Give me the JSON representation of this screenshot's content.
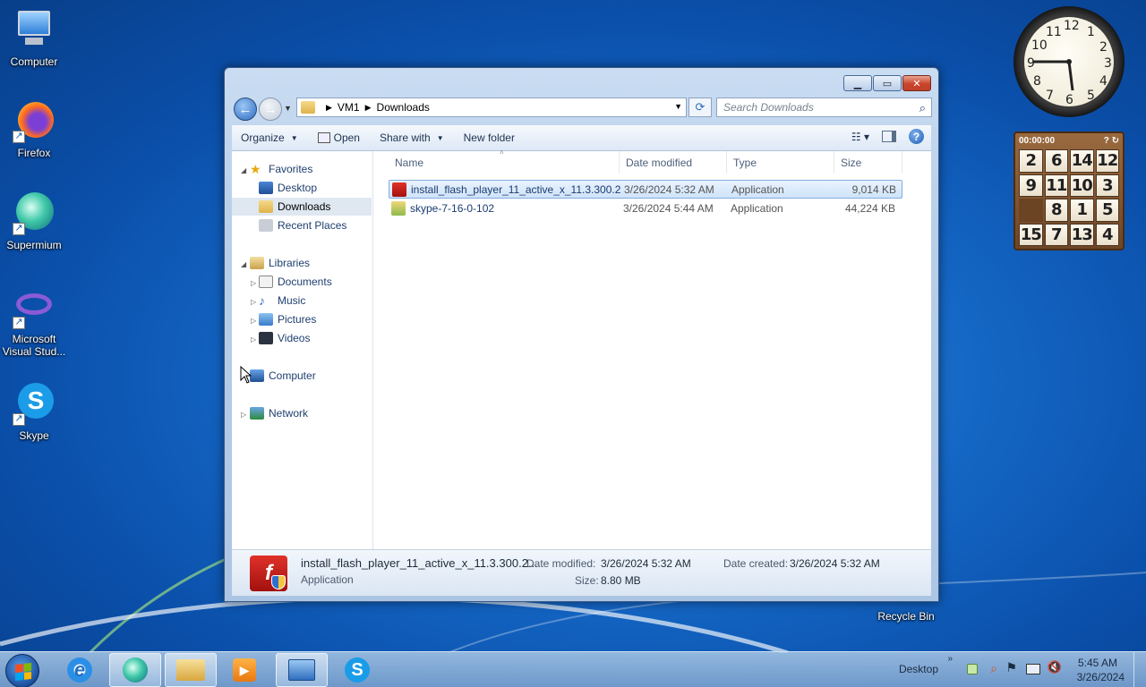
{
  "desktop": {
    "icons": [
      {
        "label": "Computer"
      },
      {
        "label": "Firefox"
      },
      {
        "label": "Supermium"
      },
      {
        "label": "Microsoft Visual Stud..."
      },
      {
        "label": "Skype"
      },
      {
        "label": "Recycle Bin"
      }
    ]
  },
  "window": {
    "address": {
      "crumbs": [
        "VM1",
        "Downloads"
      ]
    },
    "search_placeholder": "Search Downloads",
    "toolbar": {
      "organize": "Organize",
      "open": "Open",
      "share_with": "Share with",
      "new_folder": "New folder"
    },
    "nav": {
      "favorites": "Favorites",
      "desktop": "Desktop",
      "downloads": "Downloads",
      "recent_places": "Recent Places",
      "libraries": "Libraries",
      "documents": "Documents",
      "music": "Music",
      "pictures": "Pictures",
      "videos": "Videos",
      "computer": "Computer",
      "network": "Network"
    },
    "columns": {
      "name": "Name",
      "date_modified": "Date modified",
      "type": "Type",
      "size": "Size"
    },
    "files": [
      {
        "name": "install_flash_player_11_active_x_11.3.300.2...",
        "date": "3/26/2024 5:32 AM",
        "type": "Application",
        "size": "9,014 KB"
      },
      {
        "name": "skype-7-16-0-102",
        "date": "3/26/2024 5:44 AM",
        "type": "Application",
        "size": "44,224 KB"
      }
    ],
    "details": {
      "name": "install_flash_player_11_active_x_11.3.300.2...",
      "type": "Application",
      "modified_label": "Date modified:",
      "modified_value": "3/26/2024 5:32 AM",
      "size_label": "Size:",
      "size_value": "8.80 MB",
      "created_label": "Date created:",
      "created_value": "3/26/2024 5:32 AM"
    }
  },
  "gadgets": {
    "puzzle": {
      "timer": "00:00:00",
      "tiles": [
        "2",
        "6",
        "14",
        "12",
        "9",
        "11",
        "10",
        "3",
        "",
        "8",
        "1",
        "5",
        "15",
        "7",
        "13",
        "4"
      ]
    }
  },
  "taskbar": {
    "desktop_label": "Desktop",
    "time": "5:45 AM",
    "date": "3/26/2024"
  }
}
